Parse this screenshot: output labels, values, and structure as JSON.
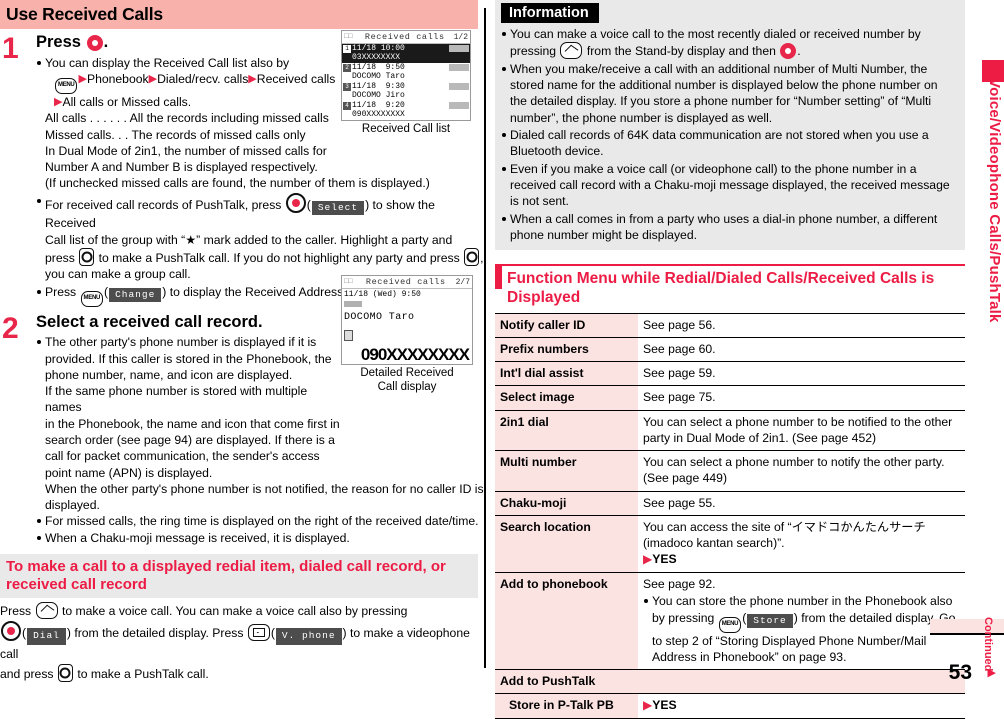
{
  "page": {
    "number": "53",
    "continued_label": "Continued",
    "side_tab_label": "Voice/Videophone Calls/PushTalk"
  },
  "left": {
    "section_title": "Use Received Calls",
    "step1": {
      "number": "1",
      "heading_before": "Press",
      "heading_after": ".",
      "bullets": [
        {
          "lines": [
            "You can display the Received Call list also by",
            "Phonebook",
            "Dialed/recv. calls",
            "Received calls",
            "All calls or Missed calls.",
            "All calls  . . . . . .  All the records including missed calls",
            "Missed calls. . .  The records of missed calls only",
            "In Dual Mode of 2in1, the number of missed calls for",
            "Number A and Number B is displayed respectively.",
            "(If unchecked missed calls are found, the number of them is displayed.)"
          ]
        },
        {
          "lines": [
            "For received call records of PushTalk, press",
            "Select",
            ") to show the Received",
            "Call list of the group with “★” mark added to the caller. Highlight a party and",
            "press",
            "to make a PushTalk call. If you do not highlight any party and press",
            ",",
            "you can make a group call."
          ]
        },
        {
          "lines": [
            "Press",
            "Change",
            ") to display the Received Address list."
          ]
        }
      ]
    },
    "step2": {
      "number": "2",
      "heading": "Select a received call record.",
      "bullets": [
        [
          "The other party's phone number is displayed if it is",
          "provided. If this caller is stored in the Phonebook, the",
          "phone number, name, and icon are displayed.",
          "If the same phone number is stored with multiple names",
          "in the Phonebook, the name and icon that come first in",
          "search order (see page 94) are displayed. If there is a",
          "call for packet communication, the sender's access",
          "point name (APN) is displayed.",
          "When the other party's phone number is not notified, the reason for no caller ID is",
          "displayed."
        ],
        [
          "For missed calls, the ring time is displayed on the right of the received date/time."
        ],
        [
          "When a Chaku-moji message is received, it is displayed."
        ]
      ]
    },
    "grey_heading": "To make a call to a displayed redial item, dialed call record, or received call record",
    "closing": {
      "l1a": "Press",
      "l1b": "to make a voice call. You can make a voice call also by pressing",
      "l2a": "Dial",
      "l2b": ") from the detailed display. Press",
      "l2c": "V. phone",
      "l2d": ") to make a videophone call",
      "l3a": "and press",
      "l3b": "to make a PushTalk call."
    },
    "shot_list": {
      "caption": "Received Call list",
      "title": "Received calls",
      "page": "1/2",
      "rows": [
        {
          "idx": "1",
          "date": "11/18",
          "time": "10:00",
          "name": "03XXXXXXXX",
          "selected": true
        },
        {
          "idx": "2",
          "date": "11/18",
          "time": "9:50",
          "name": "DOCOMO Taro",
          "selected": false
        },
        {
          "idx": "3",
          "date": "11/18",
          "time": "9:30",
          "name": "DOCOMO Jiro",
          "selected": false
        },
        {
          "idx": "4",
          "date": "11/18",
          "time": "9:20",
          "name": "090XXXXXXXX",
          "selected": false
        }
      ]
    },
    "shot_detail": {
      "caption_l1": "Detailed Received",
      "caption_l2": "Call display",
      "title": "Received calls",
      "page": "2/7",
      "datetime": "11/18 (Wed)  9:50",
      "name": "DOCOMO Taro",
      "number": "090XXXXXXXX"
    }
  },
  "right": {
    "info": {
      "title": "Information",
      "items": [
        {
          "pre": "You can make a voice call to the most recently dialed or received number by pressing",
          "mid": "from the Stand-by display and then",
          "post": "."
        },
        {
          "text": "When you make/receive a call with an additional number of Multi Number, the stored name for the additional number is displayed below the phone number on the detailed display. If you store a phone number for “Number setting” of “Multi number”, the phone number is displayed as well."
        },
        {
          "text": "Dialed call records of 64K data communication are not stored when you use a Bluetooth device."
        },
        {
          "text": "Even if you make a voice call (or videophone call) to the phone number in a received call record with a Chaku-moji message displayed, the received message is not sent."
        },
        {
          "text": "When a call comes in from a party who uses a dial-in phone number, a different phone number might be displayed."
        }
      ]
    },
    "function_menu": {
      "heading": "Function Menu while Redial/Dialed Calls/Received Calls is Displayed",
      "rows": [
        {
          "key": "Notify caller ID",
          "value": "See page 56."
        },
        {
          "key": "Prefix numbers",
          "value": "See page 60."
        },
        {
          "key": "Int'l dial assist",
          "value": "See page 59."
        },
        {
          "key": "Select image",
          "value": "See page 75."
        },
        {
          "key": "2in1 dial",
          "value": "You can select a phone number to be notified to the other party in Dual Mode of 2in1. (See page 452)"
        },
        {
          "key": "Multi number",
          "value": "You can select a phone number to notify the other party. (See page 449)"
        },
        {
          "key": "Chaku-moji",
          "value": "See page 55."
        },
        {
          "key": "Search location",
          "value": "You can access the site of “イマドコかんたんサーチ (imadoco kantan search)”.",
          "sub": "YES"
        },
        {
          "key": "Add to phonebook",
          "value": "See page 92.",
          "bullet_pre": "You can store the phone number in the Phonebook also by pressing",
          "bullet_soft": "Store",
          "bullet_post": ") from the detailed display. Go to step 2 of “Storing Displayed Phone Number/Mail Address in Phonebook” on page 93."
        },
        {
          "full": "Add to PushTalk"
        },
        {
          "sub_key": "Store in P-Talk PB",
          "sub_value": "YES"
        }
      ]
    }
  }
}
